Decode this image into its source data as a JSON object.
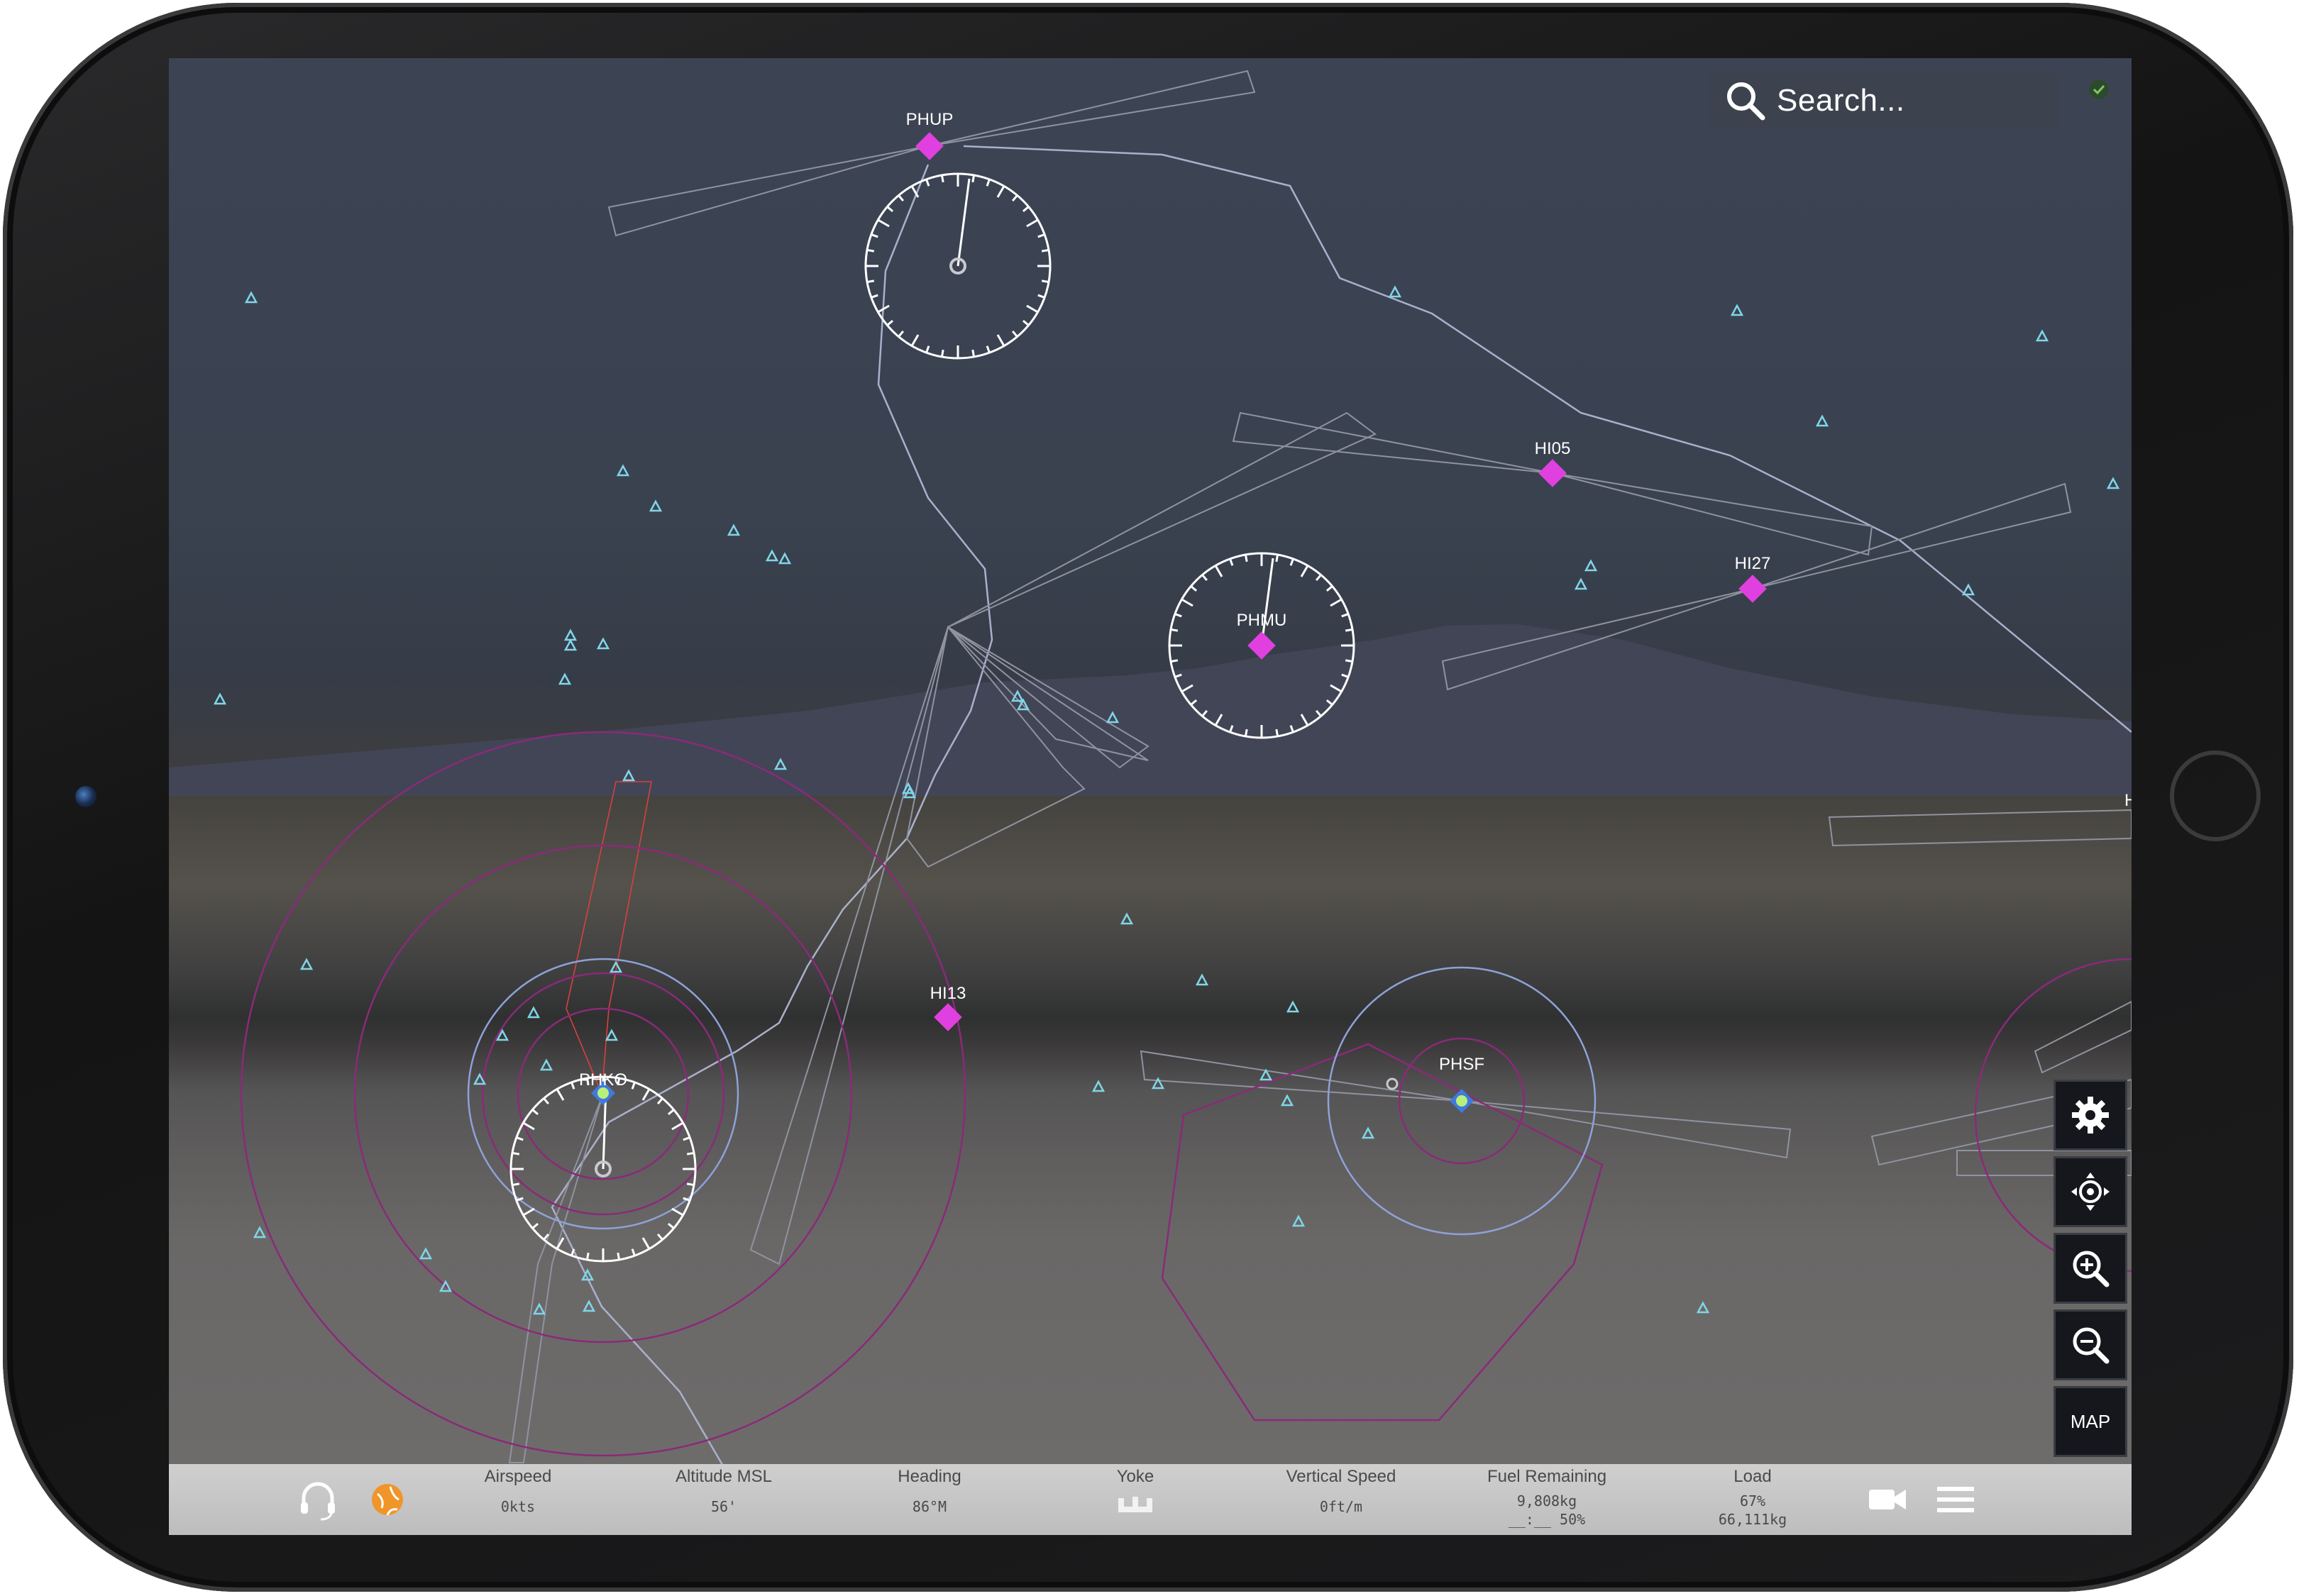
{
  "search": {
    "placeholder": "Search..."
  },
  "map": {
    "airports": [
      {
        "id": "PHUP"
      },
      {
        "id": "HI05"
      },
      {
        "id": "HI27"
      },
      {
        "id": "PHMU"
      },
      {
        "id": "HI13"
      },
      {
        "id": "PHSF"
      },
      {
        "id": "PHKO"
      }
    ],
    "edge_label": "H"
  },
  "controls": {
    "settings": "gear-icon",
    "center": "crosshair-icon",
    "zoom_in": "zoom-in-icon",
    "zoom_out": "zoom-out-icon",
    "map_label": "MAP"
  },
  "status_bar": {
    "instruments": [
      {
        "title": "Airspeed",
        "value": "0kts",
        "value2": ""
      },
      {
        "title": "Altitude MSL",
        "value": "56'",
        "value2": ""
      },
      {
        "title": "Heading",
        "value": "86°M",
        "value2": ""
      },
      {
        "title": "Yoke",
        "value": "",
        "value2": ""
      },
      {
        "title": "Vertical Speed",
        "value": "0ft/m",
        "value2": ""
      },
      {
        "title": "Fuel Remaining",
        "value": "9,808kg",
        "value2": "__:__ 50%"
      },
      {
        "title": "Load",
        "value": "67%",
        "value2": "66,111kg"
      }
    ]
  },
  "colors": {
    "airport_marker": "#e040e0",
    "waypoint": "#7fd6e8",
    "airspace": "#8a2a7a",
    "range_ring": "#8ea2d8"
  }
}
